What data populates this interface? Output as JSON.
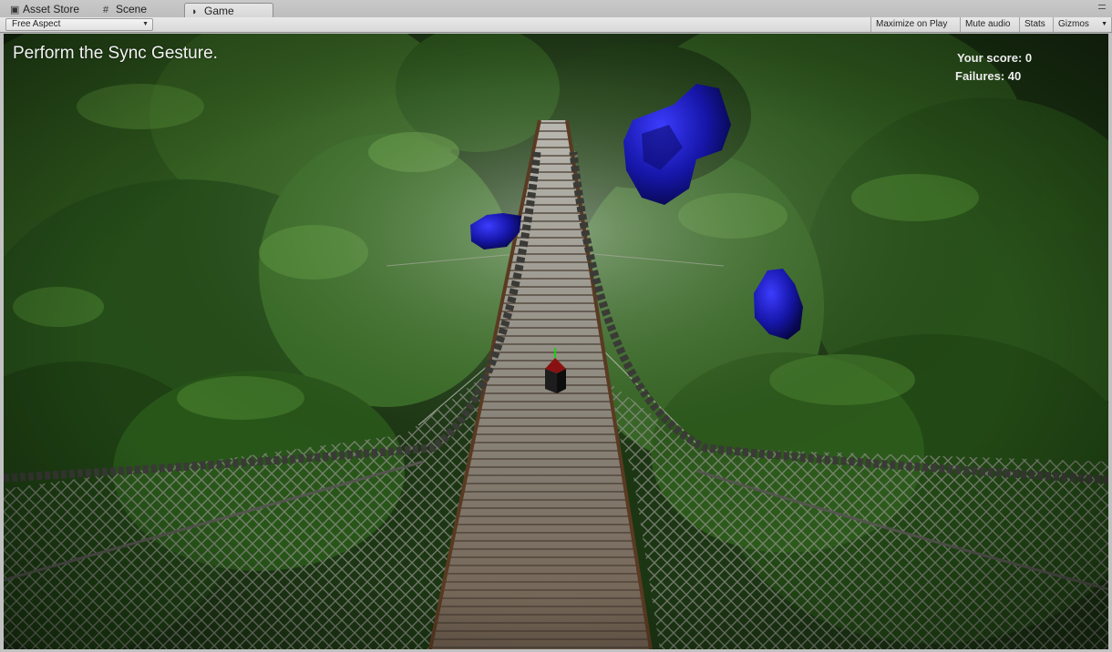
{
  "tabs": [
    {
      "label": "Asset Store",
      "icon": "shopping-bag-icon",
      "active": false
    },
    {
      "label": "Scene",
      "icon": "grid-icon",
      "active": false
    },
    {
      "label": "Game",
      "icon": "pacman-icon",
      "active": true
    }
  ],
  "toolbar": {
    "aspect": "Free Aspect",
    "maximize_on_play": "Maximize on Play",
    "mute_audio": "Mute audio",
    "stats": "Stats",
    "gizmos": "Gizmos"
  },
  "game": {
    "prompt": "Perform the Sync Gesture.",
    "score_text": "Your score: 0",
    "failures_text": "Failures: 40",
    "rock_color": "#1a1ab4",
    "foliage_color": "#2f5a1e",
    "player_cube_color": "#1a1a1a"
  }
}
